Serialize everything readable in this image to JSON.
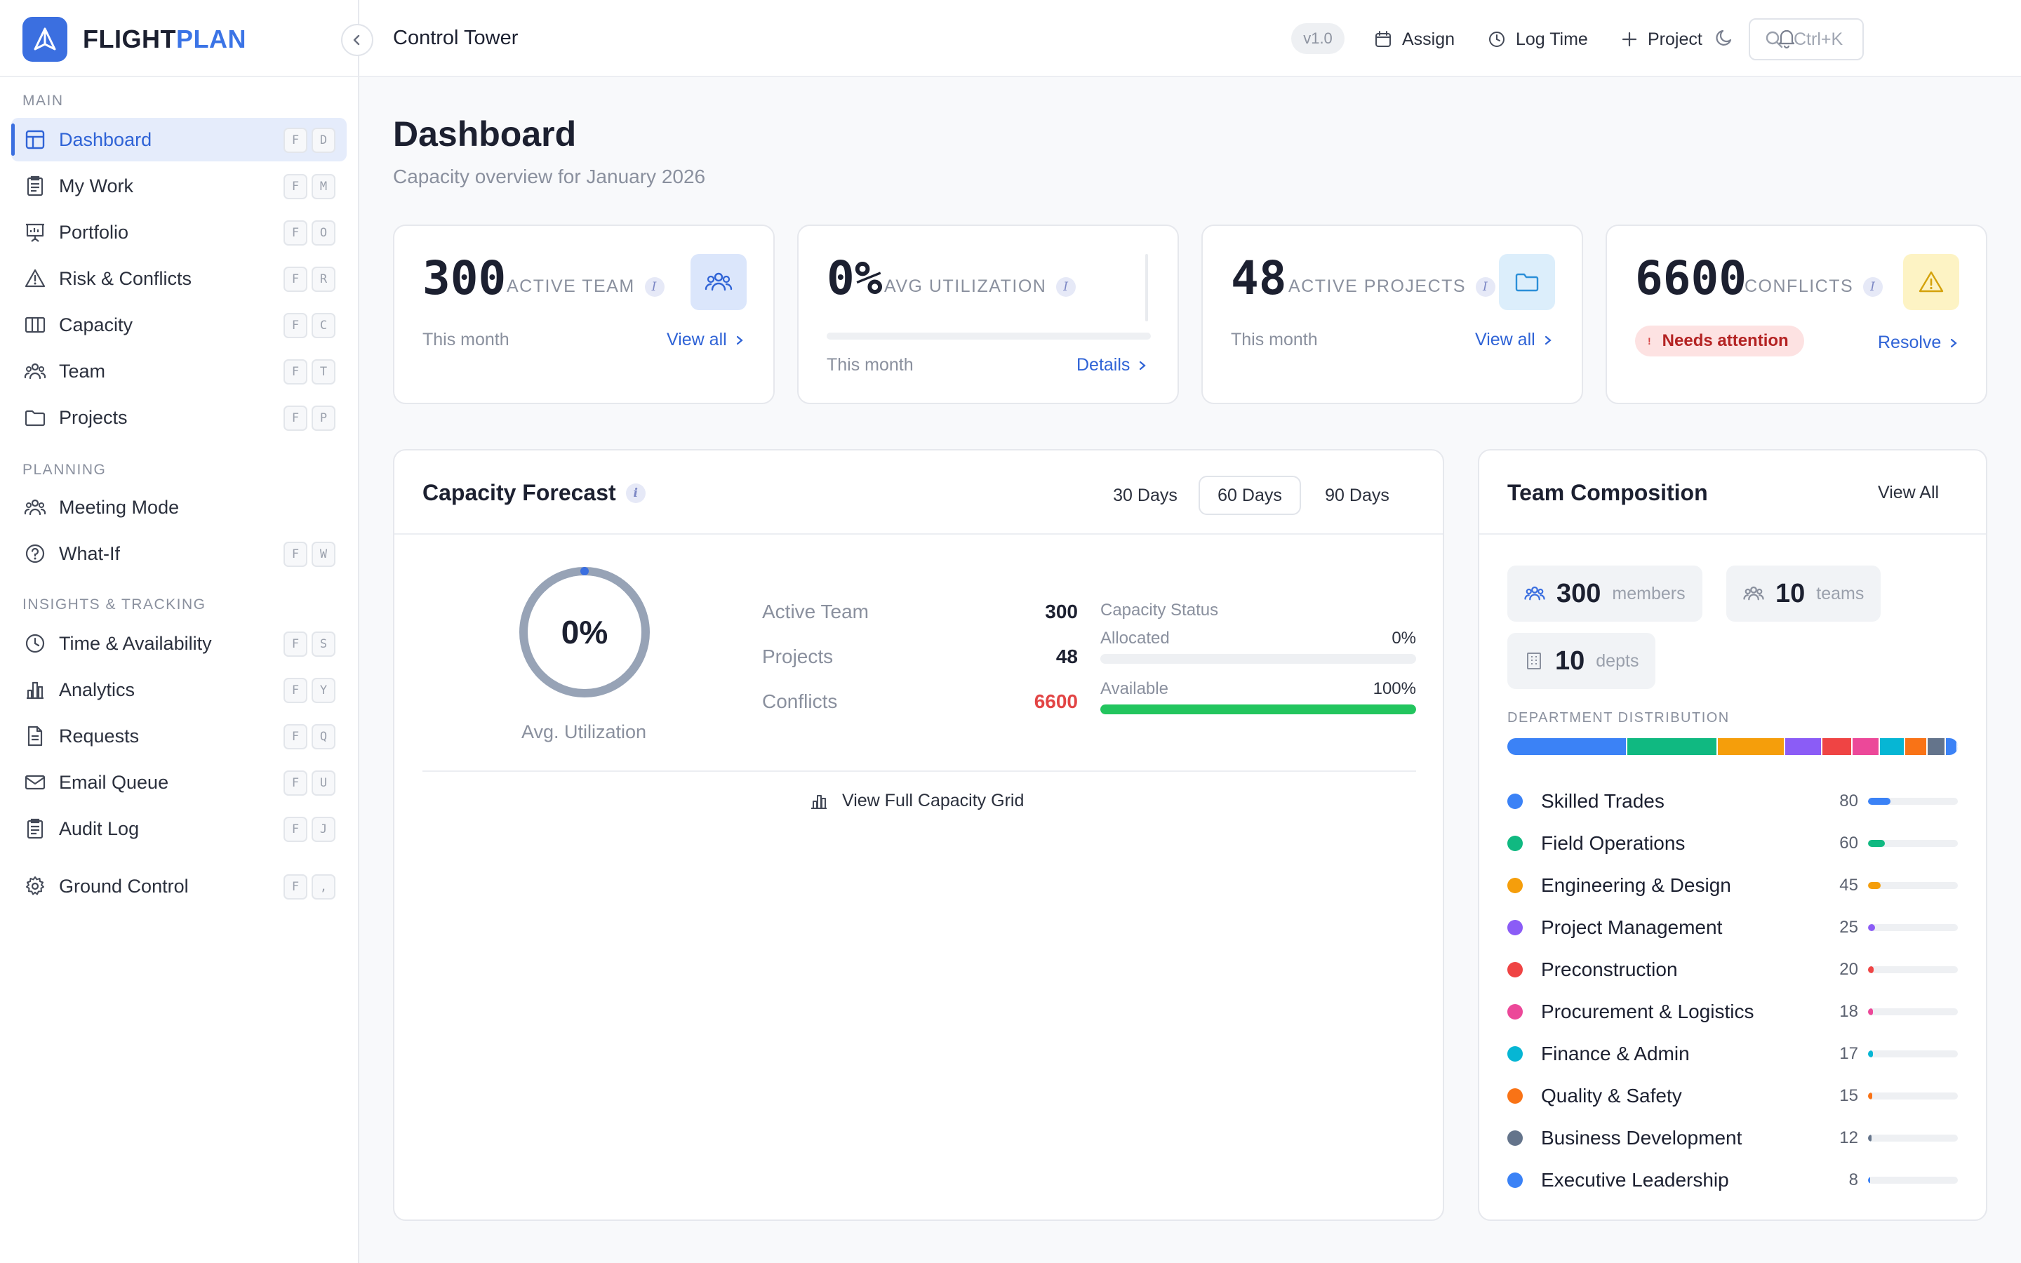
{
  "brand": {
    "name_part1": "FLIGHT",
    "name_part2": "PLAN"
  },
  "sidebar": {
    "sections": [
      {
        "label": "MAIN"
      },
      {
        "label": "PLANNING"
      },
      {
        "label": "INSIGHTS & TRACKING"
      }
    ],
    "items": [
      {
        "label": "Dashboard",
        "icon": "dashboard-icon",
        "keys": [
          "F",
          "D"
        ],
        "active": true
      },
      {
        "label": "My Work",
        "icon": "clipboard-icon",
        "keys": [
          "F",
          "M"
        ]
      },
      {
        "label": "Portfolio",
        "icon": "presentation-icon",
        "keys": [
          "F",
          "O"
        ]
      },
      {
        "label": "Risk & Conflicts",
        "icon": "warning-icon",
        "keys": [
          "F",
          "R"
        ]
      },
      {
        "label": "Capacity",
        "icon": "columns-icon",
        "keys": [
          "F",
          "C"
        ]
      },
      {
        "label": "Team",
        "icon": "team-icon",
        "keys": [
          "F",
          "T"
        ]
      },
      {
        "label": "Projects",
        "icon": "folder-icon",
        "keys": [
          "F",
          "P"
        ]
      },
      {
        "label": "Meeting Mode",
        "icon": "team-icon",
        "keys": []
      },
      {
        "label": "What-If",
        "icon": "question-icon",
        "keys": [
          "F",
          "W"
        ]
      },
      {
        "label": "Time & Availability",
        "icon": "clock-icon",
        "keys": [
          "F",
          "S"
        ]
      },
      {
        "label": "Analytics",
        "icon": "bar-chart-icon",
        "keys": [
          "F",
          "Y"
        ]
      },
      {
        "label": "Requests",
        "icon": "document-icon",
        "keys": [
          "F",
          "Q"
        ]
      },
      {
        "label": "Email Queue",
        "icon": "mail-icon",
        "keys": [
          "F",
          "U"
        ]
      },
      {
        "label": "Audit Log",
        "icon": "clipboard-check-icon",
        "keys": [
          "F",
          "J"
        ]
      },
      {
        "label": "Ground Control",
        "icon": "gear-icon",
        "keys": [
          "F",
          ","
        ]
      }
    ]
  },
  "topbar": {
    "title": "Control Tower",
    "version": "v1.0",
    "assign": "Assign",
    "log_time": "Log Time",
    "project": "Project",
    "search_placeholder": "Ctrl+K"
  },
  "page": {
    "title": "Dashboard",
    "subtitle": "Capacity overview for January  2026"
  },
  "stats": {
    "team": {
      "value": "300",
      "label": "ACTIVE TEAM",
      "foot": "This month",
      "link": "View all"
    },
    "utilization": {
      "value": "0%",
      "label": "AVG UTILIZATION",
      "foot": "This month",
      "link": "Details",
      "progress": 0
    },
    "projects": {
      "value": "48",
      "label": "ACTIVE PROJECTS",
      "foot": "This month",
      "link": "View all"
    },
    "conflicts": {
      "value": "6600",
      "label": "CONFLICTS",
      "badge": "Needs attention",
      "link": "Resolve"
    }
  },
  "forecast": {
    "title": "Capacity Forecast",
    "tabs": [
      "30 Days",
      "60 Days",
      "90 Days"
    ],
    "active_tab": "60 Days",
    "donut_value": "0%",
    "donut_label": "Avg. Utilization",
    "utilization_fraction": 0,
    "metrics": [
      {
        "label": "Active Team",
        "value": "300"
      },
      {
        "label": "Projects",
        "value": "48"
      },
      {
        "label": "Conflicts",
        "value": "6600"
      }
    ],
    "status_title": "Capacity Status",
    "allocated": {
      "label": "Allocated",
      "value": "0%",
      "percent": 0
    },
    "available": {
      "label": "Available",
      "value": "100%",
      "percent": 100
    },
    "grid_link": "View Full Capacity Grid"
  },
  "team_composition": {
    "title": "Team Composition",
    "view_all": "View All",
    "pills": [
      {
        "value": "300",
        "label": "members",
        "icon": "team-icon"
      },
      {
        "value": "10",
        "label": "teams",
        "icon": "team-icon"
      },
      {
        "value": "10",
        "label": "depts",
        "icon": "building-icon"
      }
    ],
    "distribution_title": "DEPARTMENT DISTRIBUTION",
    "departments": [
      {
        "name": "Skilled Trades",
        "count": 80,
        "color": "#3b82f6"
      },
      {
        "name": "Field Operations",
        "count": 60,
        "color": "#10b981"
      },
      {
        "name": "Engineering & Design",
        "count": 45,
        "color": "#f59e0b"
      },
      {
        "name": "Project Management",
        "count": 25,
        "color": "#8b5cf6"
      },
      {
        "name": "Preconstruction",
        "count": 20,
        "color": "#ef4444"
      },
      {
        "name": "Procurement & Logistics",
        "count": 18,
        "color": "#ec4899"
      },
      {
        "name": "Finance & Admin",
        "count": 17,
        "color": "#06b6d4"
      },
      {
        "name": "Quality & Safety",
        "count": 15,
        "color": "#f97316"
      },
      {
        "name": "Business Development",
        "count": 12,
        "color": "#64748b"
      },
      {
        "name": "Executive Leadership",
        "count": 8,
        "color": "#3b82f6"
      }
    ]
  },
  "colors": {
    "accent": "#3b6fe0",
    "danger": "#e24545",
    "success": "#22c55e",
    "donut": "#97a3b6"
  }
}
